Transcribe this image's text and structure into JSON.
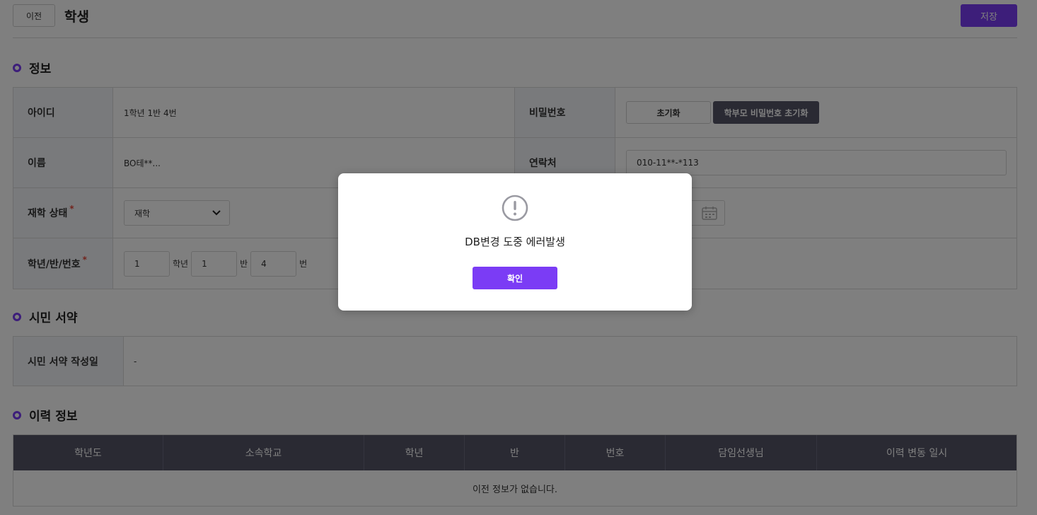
{
  "header": {
    "back_label": "이전",
    "title": "학생",
    "save_label": "저장"
  },
  "info": {
    "section_title": "정보",
    "id_label": "아이디",
    "id_value": "1학년 1반 4번",
    "password_label": "비밀번호",
    "reset_label": "초기화",
    "parent_reset_label": "학부모 비밀번호 초기화",
    "name_label": "이름",
    "name_value": "BO테**...",
    "contact_label": "연락처",
    "contact_value": "010-11**-*113",
    "status_label": "재학 상태",
    "status_value": "재학",
    "class_label": "학년/반/번호",
    "grade_value": "1",
    "grade_unit": "학년",
    "class_value": "1",
    "class_unit": "반",
    "number_value": "4",
    "number_unit": "번",
    "required_mark": "*"
  },
  "oath": {
    "section_title": "시민 서약",
    "date_label": "시민 서약 작성일",
    "date_value": "-"
  },
  "history": {
    "section_title": "이력 정보",
    "columns": [
      "학년도",
      "소속학교",
      "학년",
      "반",
      "번호",
      "담임선생님",
      "이력 변동 일시"
    ],
    "empty_message": "이전 정보가 없습니다."
  },
  "modal": {
    "icon": "exclamation-circle-icon",
    "message": "DB변경 도중 에러발생",
    "confirm_label": "확인"
  },
  "colors": {
    "accent": "#7b3cf5",
    "header_dark": "#545567",
    "label_bg": "#f3f4f8",
    "required": "#e5483b"
  }
}
